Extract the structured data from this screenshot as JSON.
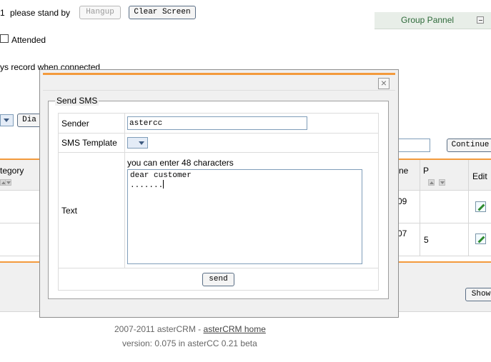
{
  "top": {
    "prefix": "1",
    "standby_text": "please stand by",
    "hangup_label": "Hangup",
    "clear_label": "Clear Screen",
    "attended_label": "Attended",
    "record_text": "ys record when connected"
  },
  "group_panel": {
    "title": "Group Pannel"
  },
  "toolbar": {
    "dial_label": "Dia",
    "continue_label": "Continue",
    "show_label": "Show"
  },
  "grid": {
    "headers": {
      "category": "tegory",
      "phone": "ne",
      "p": "P",
      "edit": "Edit"
    },
    "rows": [
      {
        "phone": "09",
        "p": ""
      },
      {
        "phone": "07",
        "p": "5"
      }
    ]
  },
  "footer": {
    "copyright": "2007-2011 asterCRM -",
    "link": "asterCRM home",
    "version": "version: 0.075 in asterCC 0.21 beta"
  },
  "modal": {
    "legend": "Send SMS",
    "sender_label": "Sender",
    "sender_value": "astercc",
    "template_label": "SMS Template",
    "text_label": "Text",
    "char_hint": "you can enter 48 characters",
    "text_line1": "dear customer",
    "text_line2": ".......",
    "send_label": "send"
  }
}
